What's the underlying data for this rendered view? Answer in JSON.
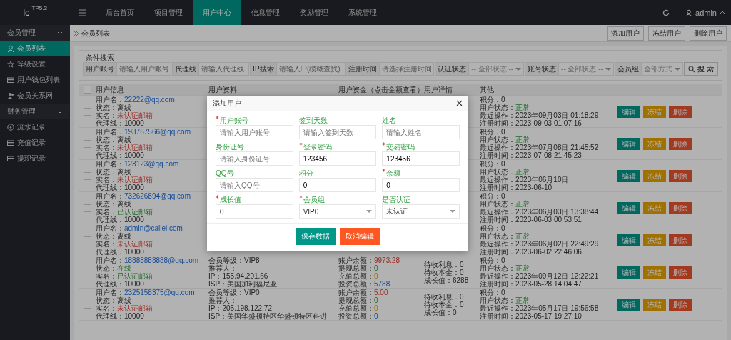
{
  "topbar": {
    "logo": "lc",
    "logo_version": "TP5.3",
    "tabs": [
      {
        "label": "后台首页",
        "selected": false
      },
      {
        "label": "项目管理",
        "selected": false
      },
      {
        "label": "用户中心",
        "selected": true
      },
      {
        "label": "信息管理",
        "selected": false
      },
      {
        "label": "奖励管理",
        "selected": false
      },
      {
        "label": "系统管理",
        "selected": false
      }
    ],
    "user": "admin"
  },
  "sidebar": {
    "groups": [
      {
        "label": "会员管理",
        "expanded": true,
        "children": [
          {
            "label": "会员列表",
            "selected": true
          },
          {
            "label": "等级设置",
            "selected": false
          },
          {
            "label": "用户钱包列表",
            "selected": false
          },
          {
            "label": "会员关系网",
            "selected": false
          }
        ]
      },
      {
        "label": "财务管理",
        "expanded": true,
        "children": [
          {
            "label": "流水记录",
            "selected": false
          },
          {
            "label": "充值记录",
            "selected": false
          },
          {
            "label": "提现记录",
            "selected": false
          }
        ]
      }
    ]
  },
  "breadcrumb": "会员列表",
  "toolbar_buttons": [
    "添加用户",
    "冻结用户",
    "删除用户"
  ],
  "search": {
    "title": "条件搜索",
    "fields": [
      {
        "label": "用户账号",
        "kind": "input",
        "placeholder": "请输入用户账号"
      },
      {
        "label": "代理线",
        "kind": "input",
        "placeholder": "请输入代理线"
      },
      {
        "label": "IP搜索",
        "kind": "input",
        "placeholder": "请输入IP(模糊查找)"
      },
      {
        "label": "注册时间",
        "kind": "input",
        "placeholder": "请选择注册时间"
      },
      {
        "label": "认证状态",
        "kind": "select",
        "placeholder": "-- 全部状态 --"
      },
      {
        "label": "账号状态",
        "kind": "select",
        "placeholder": "-- 全部状态 --"
      },
      {
        "label": "会员组",
        "kind": "select",
        "placeholder": "全部方式"
      }
    ],
    "button": "搜 索"
  },
  "table": {
    "header_checked": false,
    "columns": [
      "用户信息",
      "用户资料",
      "用户资金（点击金额查看）",
      "用户详情",
      "其他"
    ],
    "rows": [
      {
        "checked": false,
        "info": [
          {
            "label": "用户名：",
            "value": "22222@qq.com",
            "kind": "link"
          },
          {
            "label": "状态：",
            "value": "离线",
            "kind": "plain"
          },
          {
            "label": "实名：",
            "value": "未认证邮箱",
            "kind": "bad"
          },
          {
            "label": "代理线：",
            "value": "10000",
            "kind": "plain"
          }
        ],
        "other": [
          {
            "label": "积分：",
            "value": "0",
            "kind": "plain"
          },
          {
            "label": "用户状态：",
            "value": "正常",
            "kind": "ok"
          },
          {
            "label": "最近操作：",
            "value": "2023年09月03日 01:18:29",
            "kind": "plain"
          },
          {
            "label": "注册时间：",
            "value": "2023-09-03 01:07:16",
            "kind": "plain"
          }
        ],
        "actions": [
          {
            "label": "编辑",
            "kind": "edit"
          },
          {
            "label": "冻结",
            "kind": "freeze"
          },
          {
            "label": "删除",
            "kind": "delete"
          }
        ]
      },
      {
        "checked": false,
        "info": [
          {
            "label": "用户名：",
            "value": "193767566@qq.com",
            "kind": "link"
          },
          {
            "label": "状态：",
            "value": "离线",
            "kind": "plain"
          },
          {
            "label": "实名：",
            "value": "未认证邮箱",
            "kind": "bad"
          },
          {
            "label": "代理线：",
            "value": "10000",
            "kind": "plain"
          }
        ],
        "other": [
          {
            "label": "积分：",
            "value": "0",
            "kind": "plain"
          },
          {
            "label": "用户状态：",
            "value": "正常",
            "kind": "ok"
          },
          {
            "label": "最近操作：",
            "value": "2023年07月08日 21:45:52",
            "kind": "plain"
          },
          {
            "label": "注册时间：",
            "value": "2023-07-08 21:45:23",
            "kind": "plain"
          }
        ],
        "actions": [
          {
            "label": "编辑",
            "kind": "edit"
          },
          {
            "label": "冻结",
            "kind": "freeze"
          },
          {
            "label": "删除",
            "kind": "delete"
          }
        ]
      },
      {
        "checked": false,
        "info": [
          {
            "label": "用户名：",
            "value": "123123@qq.com",
            "kind": "link"
          },
          {
            "label": "状态：",
            "value": "离线",
            "kind": "plain"
          },
          {
            "label": "实名：",
            "value": "未认证邮箱",
            "kind": "bad"
          },
          {
            "label": "代理线：",
            "value": "10000",
            "kind": "plain"
          }
        ],
        "other": [
          {
            "label": "积分：",
            "value": "0",
            "kind": "plain"
          },
          {
            "label": "用户状态：",
            "value": "正常",
            "kind": "ok"
          },
          {
            "label": "最近操作：",
            "value": "2023年06月10日",
            "kind": "plain"
          },
          {
            "label": "注册时间：",
            "value": "2023-06-10",
            "kind": "plain"
          }
        ],
        "actions": [
          {
            "label": "编辑",
            "kind": "edit"
          },
          {
            "label": "冻结",
            "kind": "freeze"
          },
          {
            "label": "删除",
            "kind": "delete"
          }
        ]
      },
      {
        "checked": false,
        "info": [
          {
            "label": "用户名：",
            "value": "732626894@qq.com",
            "kind": "link"
          },
          {
            "label": "状态：",
            "value": "离线",
            "kind": "plain"
          },
          {
            "label": "实名：",
            "value": "已认证邮箱",
            "kind": "ok"
          },
          {
            "label": "代理线：",
            "value": "10000",
            "kind": "plain"
          }
        ],
        "other": [
          {
            "label": "积分：",
            "value": "0",
            "kind": "plain"
          },
          {
            "label": "用户状态：",
            "value": "正常",
            "kind": "ok"
          },
          {
            "label": "最近操作：",
            "value": "2023年06月03日 13:38:44",
            "kind": "plain"
          },
          {
            "label": "注册时间：",
            "value": "2023-06-03 00:53:51",
            "kind": "plain"
          }
        ],
        "actions": [
          {
            "label": "编辑",
            "kind": "edit"
          },
          {
            "label": "冻结",
            "kind": "freeze"
          },
          {
            "label": "删除",
            "kind": "delete"
          }
        ]
      },
      {
        "checked": false,
        "info": [
          {
            "label": "用户名：",
            "value": "admin@cailei.com",
            "kind": "link"
          },
          {
            "label": "状态：",
            "value": "离线",
            "kind": "plain"
          },
          {
            "label": "实名：",
            "value": "未认证邮箱",
            "kind": "bad"
          },
          {
            "label": "代理线：",
            "value": "10000",
            "kind": "plain"
          }
        ],
        "other": [
          {
            "label": "积分：",
            "value": "0",
            "kind": "plain"
          },
          {
            "label": "用户状态：",
            "value": "正常",
            "kind": "ok"
          },
          {
            "label": "最近操作：",
            "value": "2023年06月02日 22:49:29",
            "kind": "plain"
          },
          {
            "label": "注册时间：",
            "value": "2023-06-02 22:46:06",
            "kind": "plain"
          }
        ],
        "actions": [
          {
            "label": "编辑",
            "kind": "edit"
          },
          {
            "label": "冻结",
            "kind": "freeze"
          },
          {
            "label": "删除",
            "kind": "delete"
          }
        ]
      },
      {
        "checked": false,
        "info": [
          {
            "label": "用户名：",
            "value": "18888888888@qq.com",
            "kind": "link"
          },
          {
            "label": "状态：",
            "value": "在线",
            "kind": "ok"
          },
          {
            "label": "实名：",
            "value": "已认证邮箱",
            "kind": "ok"
          },
          {
            "label": "代理线：",
            "value": "10000",
            "kind": "plain"
          }
        ],
        "profile": [
          {
            "label": "会员等级：",
            "value": "VIP8"
          },
          {
            "label": "推荐人：",
            "value": "--"
          },
          {
            "label": "IP：",
            "value": "155.94.201.66"
          },
          {
            "label": "ISP：",
            "value": "美国加利福尼亚"
          }
        ],
        "funds": [
          {
            "label": "账户余额：",
            "value": "9973.28",
            "kind": "bad"
          },
          {
            "label": "提现总额：",
            "value": "0",
            "kind": "ok"
          },
          {
            "label": "充值总额：",
            "value": "0",
            "kind": "warn"
          },
          {
            "label": "投资总额：",
            "value": "5788",
            "kind": "link"
          }
        ],
        "details": [
          {
            "label": "待收利息：",
            "value": "0"
          },
          {
            "label": "待收本金：",
            "value": "0"
          },
          {
            "label": "成长值：",
            "value": "6288"
          }
        ],
        "other": [
          {
            "label": "积分：",
            "value": "0",
            "kind": "plain"
          },
          {
            "label": "用户状态：",
            "value": "正常",
            "kind": "ok"
          },
          {
            "label": "最近操作：",
            "value": "2023年09月12日 12:22:21",
            "kind": "plain"
          },
          {
            "label": "注册时间：",
            "value": "2023-05-28 14:04:47",
            "kind": "plain"
          }
        ],
        "actions": [
          {
            "label": "编辑",
            "kind": "edit"
          },
          {
            "label": "冻结",
            "kind": "freeze"
          },
          {
            "label": "删除",
            "kind": "delete"
          }
        ]
      },
      {
        "checked": false,
        "info": [
          {
            "label": "用户名：",
            "value": "2325158375@qq.com",
            "kind": "link"
          },
          {
            "label": "状态：",
            "value": "离线",
            "kind": "plain"
          },
          {
            "label": "实名：",
            "value": "未认证邮箱",
            "kind": "bad"
          },
          {
            "label": "代理线：",
            "value": "10000",
            "kind": "plain"
          }
        ],
        "profile": [
          {
            "label": "会员等级：",
            "value": "VIP0"
          },
          {
            "label": "推荐人：",
            "value": "--"
          },
          {
            "label": "IP：",
            "value": "205.198.122.72"
          },
          {
            "label": "ISP：",
            "value": "美国华盛顿特区华盛顿特区科进"
          }
        ],
        "funds": [
          {
            "label": "账户余额：",
            "value": "5.00",
            "kind": "bad"
          },
          {
            "label": "提现总额：",
            "value": "0",
            "kind": "ok"
          },
          {
            "label": "充值总额：",
            "value": "0",
            "kind": "warn"
          },
          {
            "label": "投资总额：",
            "value": "0",
            "kind": "link"
          }
        ],
        "details": [
          {
            "label": "待收利息：",
            "value": "0"
          },
          {
            "label": "待收本金：",
            "value": "0"
          },
          {
            "label": "成长值：",
            "value": "0"
          }
        ],
        "other": [
          {
            "label": "积分：",
            "value": "0",
            "kind": "plain"
          },
          {
            "label": "用户状态：",
            "value": "正常",
            "kind": "ok"
          },
          {
            "label": "最近操作：",
            "value": "2023年05月17日 19:56:58",
            "kind": "plain"
          },
          {
            "label": "注册时间：",
            "value": "2023-05-17 19:27:10",
            "kind": "plain"
          }
        ],
        "actions": [
          {
            "label": "编辑",
            "kind": "edit"
          },
          {
            "label": "冻结",
            "kind": "freeze"
          },
          {
            "label": "删除",
            "kind": "delete"
          }
        ]
      }
    ]
  },
  "modal": {
    "title": "添加用户",
    "fields": [
      {
        "label": "用户账号",
        "required": true,
        "kind": "input",
        "placeholder": "请输入用户账号"
      },
      {
        "label": "签到天数",
        "required": false,
        "kind": "input",
        "placeholder": "请输入签到天数"
      },
      {
        "label": "姓名",
        "required": false,
        "kind": "input",
        "placeholder": "请输入姓名"
      },
      {
        "label": "身份证号",
        "required": false,
        "kind": "input",
        "placeholder": "请输入身份证号"
      },
      {
        "label": "登录密码",
        "required": true,
        "kind": "input",
        "value": "123456"
      },
      {
        "label": "交易密码",
        "required": true,
        "kind": "input",
        "value": "123456"
      },
      {
        "label": "QQ号",
        "required": false,
        "kind": "input",
        "placeholder": "请输入QQ号"
      },
      {
        "label": "积分",
        "required": false,
        "kind": "input",
        "value": "0"
      },
      {
        "label": "余额",
        "required": true,
        "kind": "input",
        "value": "0"
      },
      {
        "label": "成长值",
        "required": true,
        "kind": "input",
        "value": "0"
      },
      {
        "label": "会员组",
        "required": true,
        "kind": "select",
        "value": "VIP0"
      },
      {
        "label": "是否认证",
        "required": false,
        "kind": "select",
        "value": "未认证"
      }
    ],
    "buttons": [
      {
        "label": "保存数据",
        "kind": "primary"
      },
      {
        "label": "取消编辑",
        "kind": "danger"
      }
    ]
  }
}
